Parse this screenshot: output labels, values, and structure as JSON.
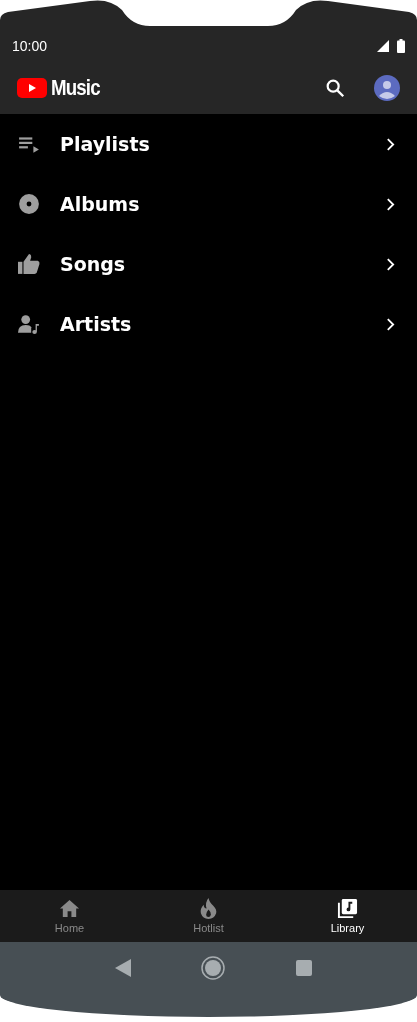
{
  "status_bar": {
    "time": "10:00"
  },
  "app_bar": {
    "logo_text": "Music"
  },
  "library_items": [
    {
      "label": "Playlists",
      "kind": "playlist"
    },
    {
      "label": "Albums",
      "kind": "album"
    },
    {
      "label": "Songs",
      "kind": "liked"
    },
    {
      "label": "Artists",
      "kind": "artist"
    }
  ],
  "bottom_nav": [
    {
      "label": "Home",
      "kind": "home",
      "selected": false
    },
    {
      "label": "Hotlist",
      "kind": "hotlist",
      "selected": false
    },
    {
      "label": "Library",
      "kind": "library",
      "selected": true
    }
  ]
}
